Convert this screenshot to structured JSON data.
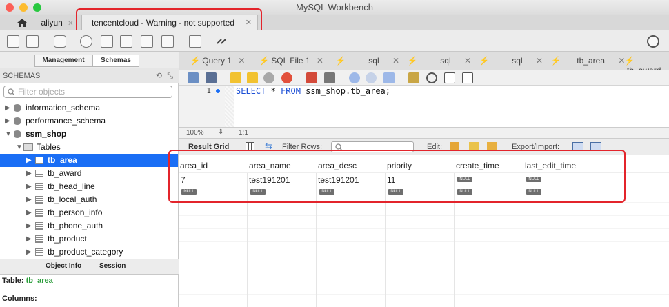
{
  "window": {
    "title": "MySQL Workbench"
  },
  "connection_tabs": [
    {
      "label": "aliyun",
      "active": false
    },
    {
      "label": "tencentcloud - Warning - not supported",
      "active": true
    }
  ],
  "sidebar": {
    "modes": [
      "Management",
      "Schemas"
    ],
    "header": "SCHEMAS",
    "filter_placeholder": "Filter objects",
    "schemas": [
      {
        "label": "information_schema"
      },
      {
        "label": "performance_schema"
      },
      {
        "label": "ssm_shop"
      }
    ],
    "tables_label": "Tables",
    "tables": [
      "tb_area",
      "tb_award",
      "tb_head_line",
      "tb_local_auth",
      "tb_person_info",
      "tb_phone_auth",
      "tb_product",
      "tb_product_category"
    ],
    "selected_table": "tb_area"
  },
  "info_panel": {
    "tabs": [
      "Object Info",
      "Session"
    ],
    "table_label": "Table:",
    "table_name": "tb_area",
    "columns_label": "Columns:"
  },
  "query_tabs": [
    "Query 1",
    "SQL File 1",
    "sql",
    "sql",
    "sql",
    "tb_area",
    "tb_award"
  ],
  "editor": {
    "line_number": "1",
    "sql": {
      "select": "SELECT",
      "star": " * ",
      "from": "FROM",
      "rest": " ssm_shop.tb_area;"
    }
  },
  "status": {
    "zoom": "100%",
    "position": "1:1"
  },
  "result_toolbar": {
    "result_grid": "Result Grid",
    "filter_rows": "Filter Rows:",
    "edit": "Edit:",
    "export_import": "Export/Import:"
  },
  "result_grid": {
    "columns": [
      "area_id",
      "area_name",
      "area_desc",
      "priority",
      "create_time",
      "last_edit_time"
    ],
    "rows": [
      [
        "7",
        "test191201",
        "test191201",
        "11",
        "NULL",
        "NULL"
      ],
      [
        "NULL",
        "NULL",
        "NULL",
        "NULL",
        "NULL",
        "NULL"
      ]
    ]
  },
  "colors": {
    "accent": "#1a6ef5",
    "highlight": "#e3242b"
  }
}
